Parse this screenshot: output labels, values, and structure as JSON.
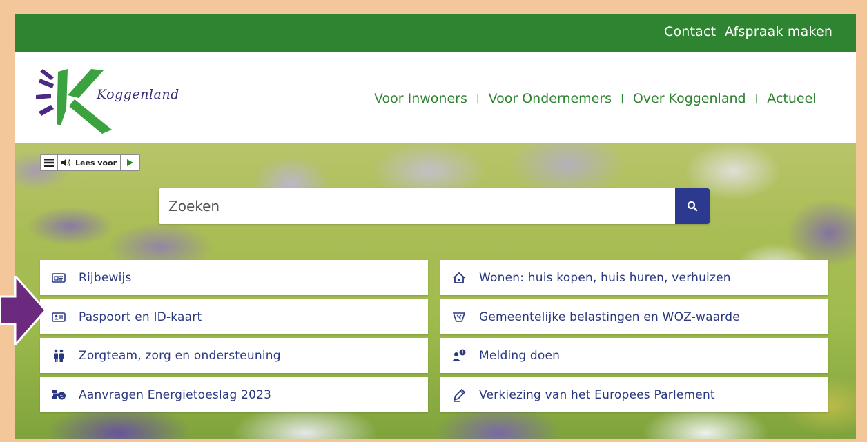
{
  "topbar": {
    "contact": "Contact",
    "afspraak": "Afspraak maken"
  },
  "logo": {
    "text": "Koggenland"
  },
  "nav": [
    {
      "label": "Voor Inwoners"
    },
    {
      "label": "Voor Ondernemers"
    },
    {
      "label": "Over Koggenland"
    },
    {
      "label": "Actueel"
    }
  ],
  "readspeaker": {
    "label": "Lees voor"
  },
  "search": {
    "placeholder": "Zoeken"
  },
  "tiles": [
    {
      "label": "Rijbewijs",
      "icon": "id-card-icon"
    },
    {
      "label": "Wonen: huis kopen, huis huren, verhuizen",
      "icon": "house-icon"
    },
    {
      "label": "Paspoort en ID-kaart",
      "icon": "passport-icon"
    },
    {
      "label": "Gemeentelijke belastingen en WOZ-waarde",
      "icon": "tax-icon"
    },
    {
      "label": "Zorgteam, zorg en ondersteuning",
      "icon": "people-icon"
    },
    {
      "label": "Melding doen",
      "icon": "report-icon"
    },
    {
      "label": "Aanvragen Energietoeslag 2023",
      "icon": "money-icon"
    },
    {
      "label": "Verkiezing van het Europees Parlement",
      "icon": "pencil-icon"
    }
  ],
  "colors": {
    "green": "#2e8430",
    "navy": "#2a3880",
    "search_button": "#2b3a8f",
    "arrow": "#6b2a7e",
    "frame": "#f3c79a"
  }
}
